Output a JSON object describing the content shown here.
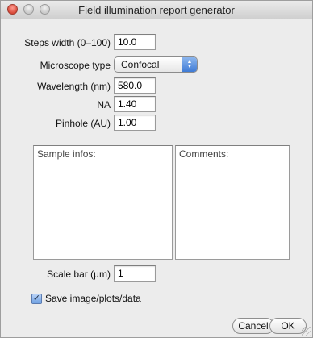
{
  "window": {
    "title": "Field illumination report generator"
  },
  "form": {
    "steps_label": "Steps width (0–100)",
    "steps_value": "10.0",
    "microscope_label": "Microscope type",
    "microscope_selected": "Confocal",
    "wavelength_label": "Wavelength (nm)",
    "wavelength_value": "580.0",
    "na_label": "NA",
    "na_value": "1.40",
    "pinhole_label": "Pinhole (AU)",
    "pinhole_value": "1.00",
    "sample_infos_text": "Sample infos:",
    "comments_text": "Comments:",
    "scale_bar_label": "Scale bar (µm)",
    "scale_bar_value": "1",
    "save_label": "Save image/plots/data",
    "save_checked": true
  },
  "buttons": {
    "cancel": "Cancel",
    "ok": "OK"
  },
  "icons": {
    "close": "close-icon",
    "minimize": "minimize-icon",
    "zoom": "zoom-icon",
    "stepper": "select-stepper-icon",
    "checkbox": "checkbox-icon"
  }
}
